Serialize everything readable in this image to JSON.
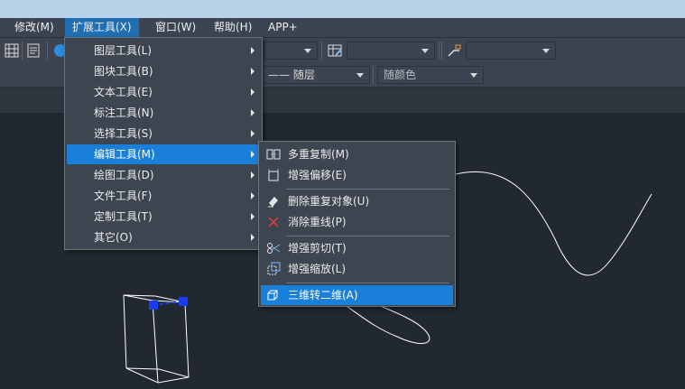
{
  "menubar": {
    "items": [
      {
        "label": "修改(M)"
      },
      {
        "label": "扩展工具(X)"
      },
      {
        "label": "窗口(W)"
      },
      {
        "label": "帮助(H)"
      },
      {
        "label": "APP+"
      }
    ]
  },
  "toolbar": {
    "linetype_value": "—— 随层",
    "color_value": "随颜色"
  },
  "ext_menu": {
    "items": [
      {
        "label": "图层工具(L)"
      },
      {
        "label": "图块工具(B)"
      },
      {
        "label": "文本工具(E)"
      },
      {
        "label": "标注工具(N)"
      },
      {
        "label": "选择工具(S)"
      },
      {
        "label": "编辑工具(M)"
      },
      {
        "label": "绘图工具(D)"
      },
      {
        "label": "文件工具(F)"
      },
      {
        "label": "定制工具(T)"
      },
      {
        "label": "其它(O)"
      }
    ],
    "highlighted_index": 5
  },
  "edit_submenu": {
    "items": [
      {
        "label": "多重复制(M)",
        "icon": "multi-copy-icon"
      },
      {
        "label": "增强偏移(E)",
        "icon": "offset-icon"
      },
      {
        "label": "删除重复对象(U)",
        "icon": "delete-duplicates-icon"
      },
      {
        "label": "消除重线(P)",
        "icon": "remove-overlap-icon"
      },
      {
        "label": "增强剪切(T)",
        "icon": "trim-icon"
      },
      {
        "label": "增强缩放(L)",
        "icon": "scale-icon"
      },
      {
        "label": "三维转二维(A)",
        "icon": "3d-to-2d-icon"
      }
    ],
    "highlighted_index": 6
  },
  "colors": {
    "menu_bg": "#3d4550",
    "highlight": "#1a7fd8",
    "canvas": "#212830",
    "grip": "#1a3cf0"
  }
}
